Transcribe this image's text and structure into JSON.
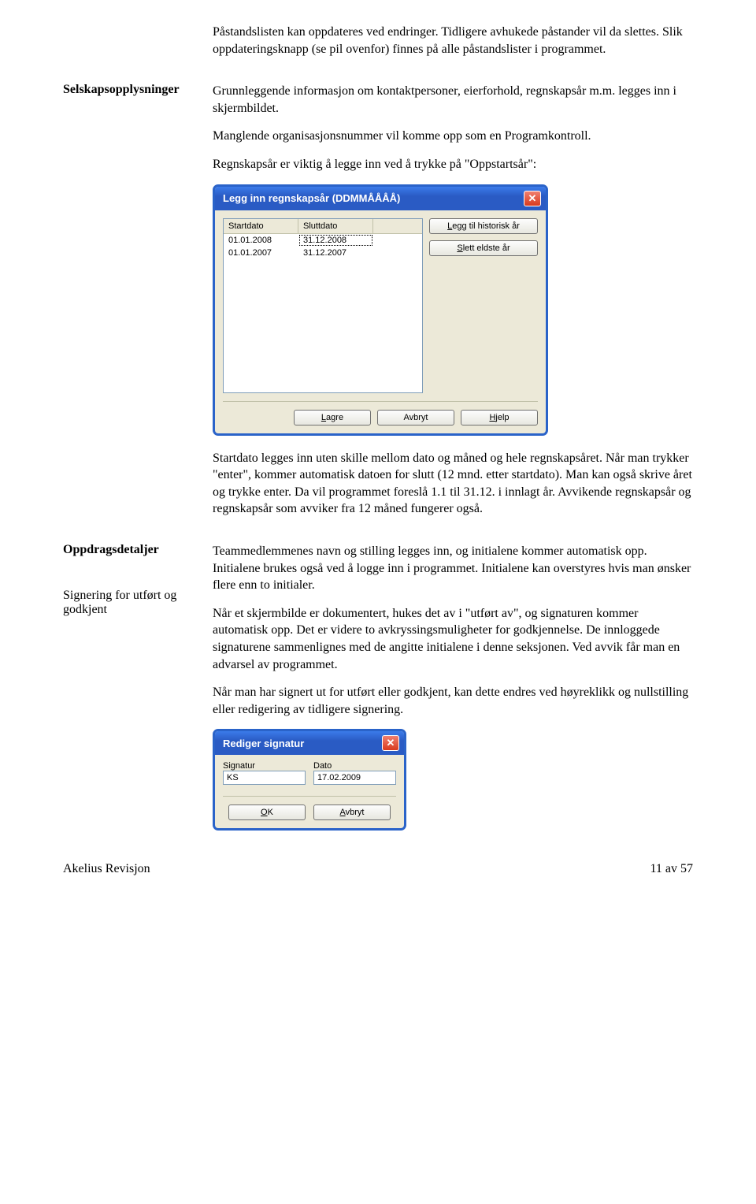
{
  "intro": {
    "p1": "Påstandslisten kan oppdateres ved endringer. Tidligere avhukede påstander vil da slettes. Slik oppdateringsknapp (se pil ovenfor) finnes på alle påstandslister i programmet."
  },
  "section_selskapsopplysninger": {
    "label": "Selskapsopplysninger",
    "p1": "Grunnleggende informasjon om kontaktpersoner, eierforhold, regnskapsår m.m. legges inn i skjermbildet.",
    "p2": "Manglende organisasjonsnummer vil komme opp som en Programkontroll.",
    "p3": "Regnskapsår er viktig å legge inn ved å trykke på \"Oppstartsår\":",
    "p_after": "Startdato legges inn uten skille mellom dato og måned og hele regnskapsåret. Når man trykker \"enter\", kommer automatisk datoen for slutt (12 mnd. etter startdato). Man kan også skrive året og trykke enter. Da vil programmet foreslå 1.1 til 31.12. i innlagt år. Avvikende regnskapsår og regnskapsår som avviker fra 12 måned fungerer også."
  },
  "dialog1": {
    "title": "Legg inn regnskapsår (DDMMÅÅÅÅ)",
    "col1": "Startdato",
    "col2": "Sluttdato",
    "rows": [
      {
        "start": "01.01.2008",
        "slutt": "31.12.2008"
      },
      {
        "start": "01.01.2007",
        "slutt": "31.12.2007"
      }
    ],
    "btn_hist": "Legg til historisk år",
    "btn_slett": "Slett eldste år",
    "btn_lagre": "Lagre",
    "btn_avbryt": "Avbryt",
    "btn_hjelp": "Hjelp"
  },
  "section_oppdragsdetaljer": {
    "label": "Oppdragsdetaljer",
    "sublabel": "Signering for utført og godkjent",
    "p1": "Teammedlemmenes navn og stilling legges inn, og initialene kommer automatisk opp. Initialene brukes også ved å logge inn i programmet. Initialene kan overstyres hvis man ønsker flere enn to initialer.",
    "p2": "Når et skjermbilde er dokumentert, hukes det av i \"utført av\", og signaturen kommer automatisk opp. Det er videre to avkryssingsmuligheter for godkjennelse. De innloggede signaturene sammenlignes med de angitte initialene i denne seksjonen. Ved avvik får man en advarsel av programmet.",
    "p3": "Når man har signert ut for utført eller godkjent, kan dette endres ved høyreklikk og nullstilling eller redigering av tidligere signering."
  },
  "dialog2": {
    "title": "Rediger signatur",
    "label_sig": "Signatur",
    "label_dato": "Dato",
    "val_sig": "KS",
    "val_dato": "17.02.2009",
    "btn_ok": "OK",
    "btn_avbryt": "Avbryt"
  },
  "footer": {
    "left": "Akelius Revisjon",
    "right": "11 av 57"
  }
}
